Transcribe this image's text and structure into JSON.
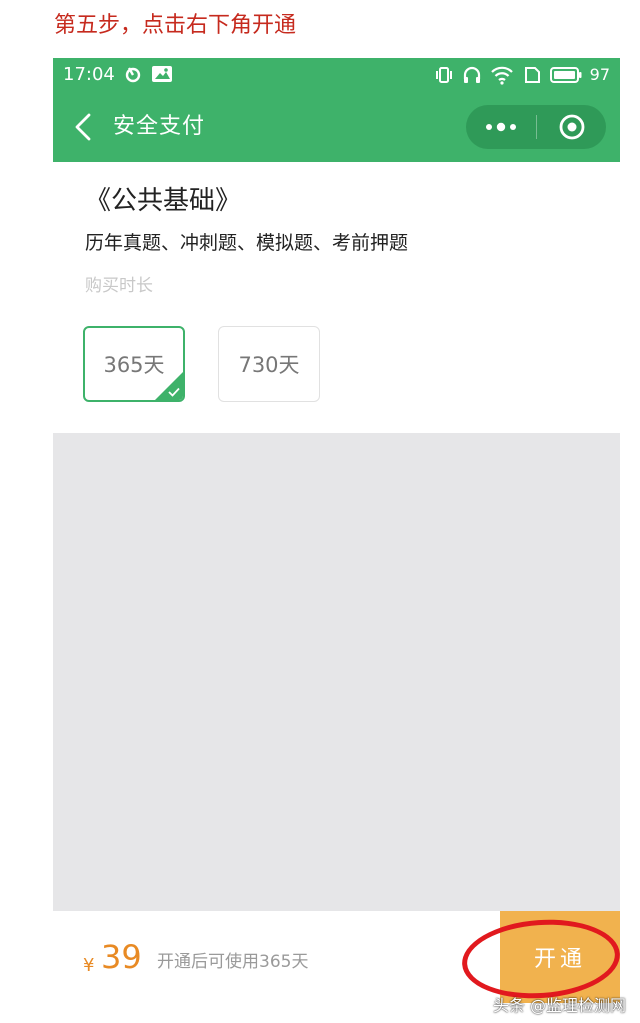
{
  "caption": "第五步，点击右下角开通",
  "status_bar": {
    "time": "17:04",
    "battery_level": "97"
  },
  "nav": {
    "title": "安全支付",
    "icons": [
      "back-icon",
      "more-dots-icon",
      "close-target-icon"
    ]
  },
  "product": {
    "name": "《公共基础》",
    "description": "历年真题、冲刺题、模拟题、考前押题",
    "duration_label": "购买时长",
    "options": [
      {
        "label": "365天",
        "selected": true
      },
      {
        "label": "730天",
        "selected": false
      }
    ]
  },
  "bottom_bar": {
    "currency": "¥",
    "price": "39",
    "note": "开通后可使用365天",
    "button_label": "开通"
  },
  "watermark": "头条 @监理检测网",
  "colors": {
    "brand_green": "#3eb26a",
    "button_orange": "#f1b24e",
    "price_orange": "#e88a24",
    "annotation_red": "#e1191e",
    "caption_red": "#c62a1e"
  }
}
